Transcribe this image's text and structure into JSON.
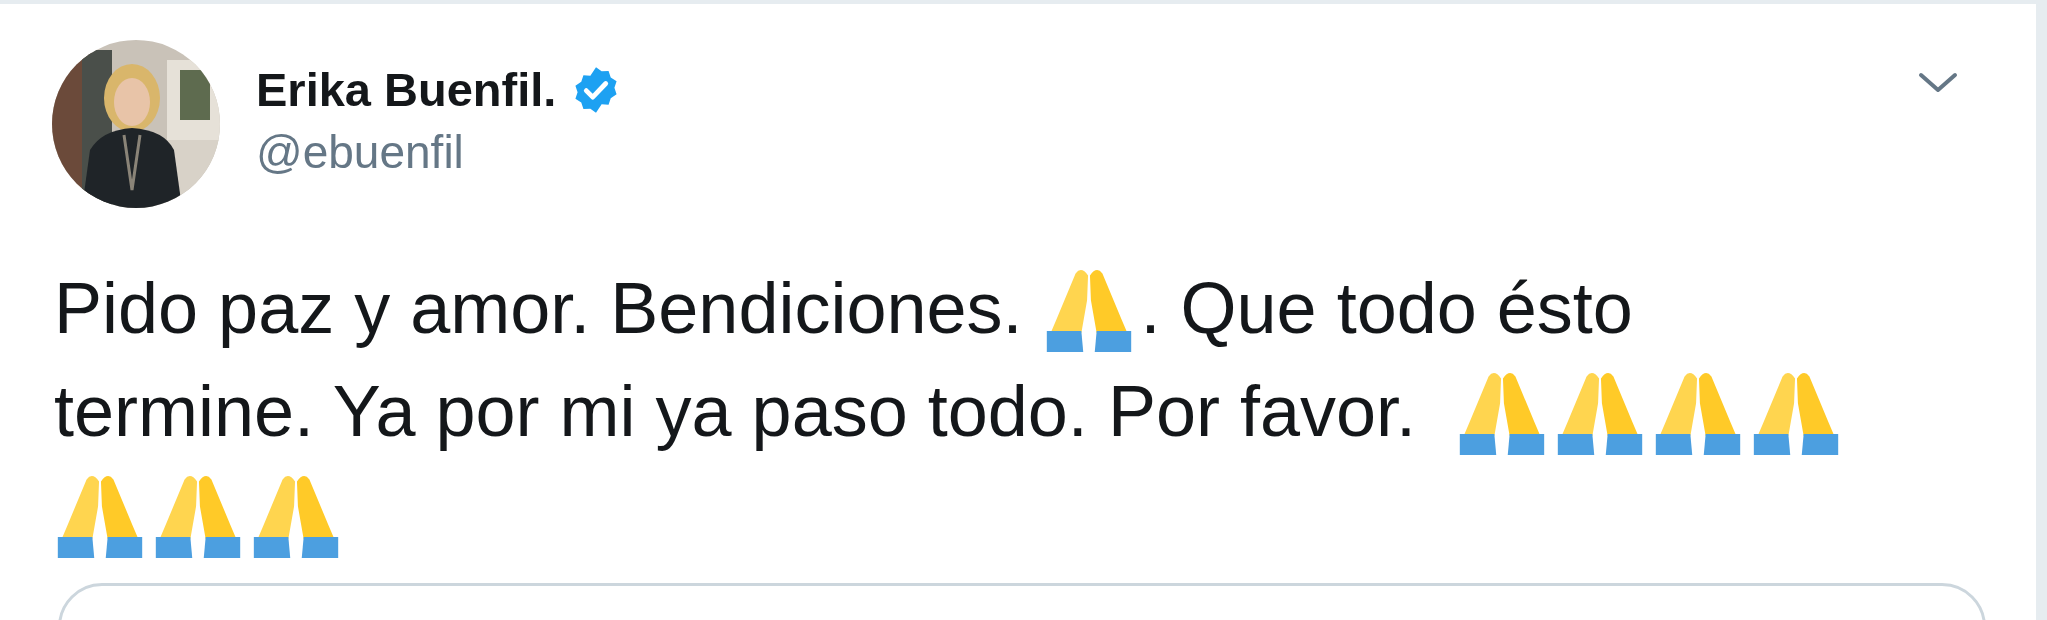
{
  "author": {
    "name": "Erika Buenfil.",
    "verified": true,
    "handle": "@ebuenfil"
  },
  "body_lines": [
    [
      {
        "kind": "text",
        "text": "Pido paz y amor. Bendiciones. "
      },
      {
        "kind": "emoji"
      },
      {
        "kind": "text",
        "text": ". Que todo ésto"
      }
    ],
    [
      {
        "kind": "text",
        "text": "termine. Ya por mi ya paso todo. Por favor.  "
      },
      {
        "kind": "emoji"
      },
      {
        "kind": "emoji"
      },
      {
        "kind": "emoji"
      },
      {
        "kind": "emoji"
      }
    ],
    [
      {
        "kind": "emoji"
      },
      {
        "kind": "emoji"
      },
      {
        "kind": "emoji"
      }
    ]
  ]
}
